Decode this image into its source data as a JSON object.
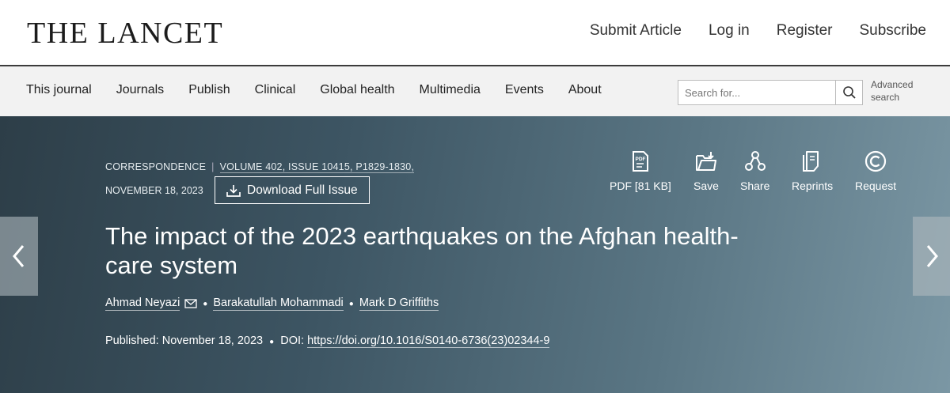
{
  "header": {
    "logo": "THE LANCET",
    "links": [
      "Submit Article",
      "Log in",
      "Register",
      "Subscribe"
    ]
  },
  "nav": {
    "items": [
      "This journal",
      "Journals",
      "Publish",
      "Clinical",
      "Global health",
      "Multimedia",
      "Events",
      "About"
    ],
    "search_placeholder": "Search for...",
    "advanced_line1": "Advanced",
    "advanced_line2": "search"
  },
  "article": {
    "type": "CORRESPONDENCE",
    "volume": "VOLUME 402, ISSUE 10415, P1829-1830,",
    "date": "NOVEMBER 18, 2023",
    "download_label": "Download Full Issue",
    "title": "The impact of the 2023 earthquakes on the Afghan health-care system",
    "authors": [
      "Ahmad Neyazi",
      "Barakatullah Mohammadi",
      "Mark D Griffiths"
    ],
    "published_label": "Published:",
    "published_date": "November 18, 2023",
    "doi_label": "DOI:",
    "doi": "https://doi.org/10.1016/S0140-6736(23)02344-9"
  },
  "tools": {
    "pdf": "PDF [81 KB]",
    "save": "Save",
    "share": "Share",
    "reprints": "Reprints",
    "request": "Request"
  },
  "icons": [
    "envelope-icon",
    "download-icon",
    "pdf-icon",
    "save-folder-icon",
    "share-icon",
    "reprints-icon",
    "copyright-icon",
    "search-icon",
    "chevron-left-icon",
    "chevron-right-icon"
  ]
}
